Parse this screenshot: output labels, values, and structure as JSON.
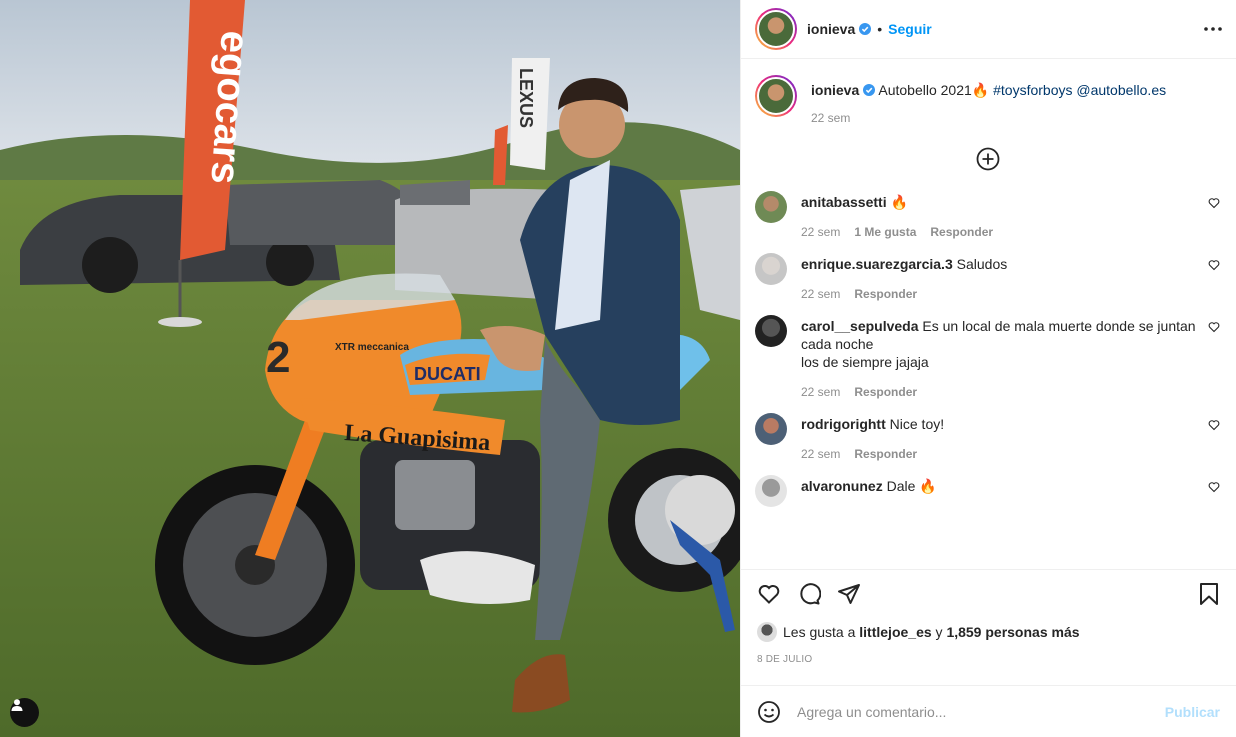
{
  "post": {
    "username": "ionieva",
    "follow_label": "Seguir",
    "dot": "•",
    "caption_text": "Autobello 2021",
    "caption_emoji": "🔥",
    "caption_tags": "#toysforboys @autobello.es",
    "caption_time": "22 sem",
    "photo_texts": {
      "banner": "egocars",
      "lexus": "LEXUS",
      "bike_number": "2",
      "bike_brand": "DUCATI",
      "bike_name": "La Guapisima",
      "fairing": "XTR meccanica"
    }
  },
  "comments": [
    {
      "user": "anitabassetti",
      "text": "🔥",
      "time": "22 sem",
      "likes": "1 Me gusta",
      "reply": "Responder"
    },
    {
      "user": "enrique.suarezgarcia.3",
      "text": "Saludos",
      "time": "22 sem",
      "likes": "",
      "reply": "Responder"
    },
    {
      "user": "carol__sepulveda",
      "text": "Es un local de mala muerte donde se juntan cada noche",
      "text2": "los de siempre jajaja",
      "time": "22 sem",
      "likes": "",
      "reply": "Responder"
    },
    {
      "user": "rodrigorightt",
      "text": "Nice toy!",
      "time": "22 sem",
      "likes": "",
      "reply": "Responder"
    },
    {
      "user": "alvaronunez",
      "text": "Dale 🔥",
      "time": "",
      "likes": "",
      "reply": ""
    }
  ],
  "likes": {
    "prefix": "Les gusta a",
    "user": "littlejoe_es",
    "middle": "y",
    "count": "1,859 personas más"
  },
  "date": "8 DE JULIO",
  "composer": {
    "placeholder": "Agrega un comentario...",
    "publish_label": "Publicar"
  },
  "colors": {
    "accent": "#0095f6",
    "publish_disabled": "#b2dffc",
    "muted": "#8e8e8e"
  }
}
